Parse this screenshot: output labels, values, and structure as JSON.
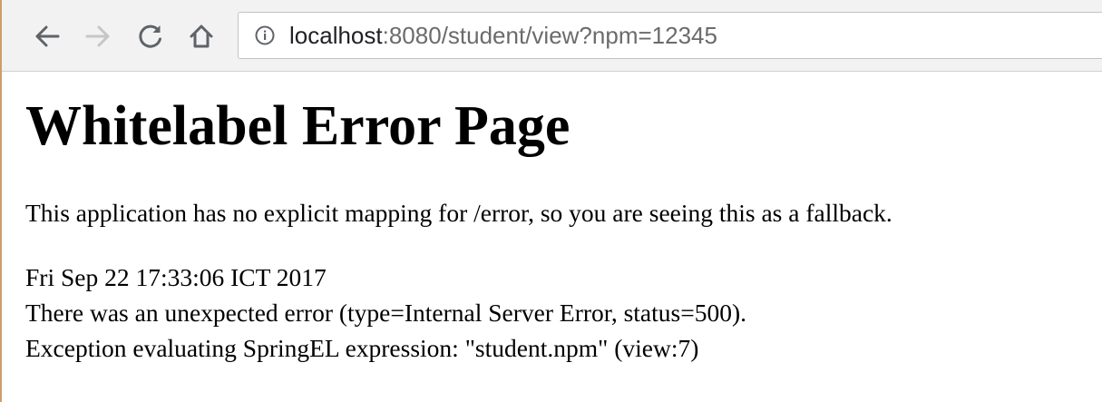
{
  "browser": {
    "url_host": "localhost",
    "url_rest": ":8080/student/view?npm=12345"
  },
  "page": {
    "title": "Whitelabel Error Page",
    "message": "This application has no explicit mapping for /error, so you are seeing this as a fallback.",
    "timestamp": "Fri Sep 22 17:33:06 ICT 2017",
    "error_line": "There was an unexpected error (type=Internal Server Error, status=500).",
    "exception_line": "Exception evaluating SpringEL expression: \"student.npm\" (view:7)"
  },
  "icons": {
    "back": "arrow-left-icon",
    "forward": "arrow-right-icon",
    "reload": "reload-icon",
    "home": "home-icon",
    "info": "info-icon"
  },
  "colors": {
    "toolbar_bg": "#f2f2f2",
    "icon_active": "#5f6368",
    "icon_disabled": "#c6c6c6",
    "url_host": "#202124",
    "url_rest": "#6b6b6b"
  }
}
